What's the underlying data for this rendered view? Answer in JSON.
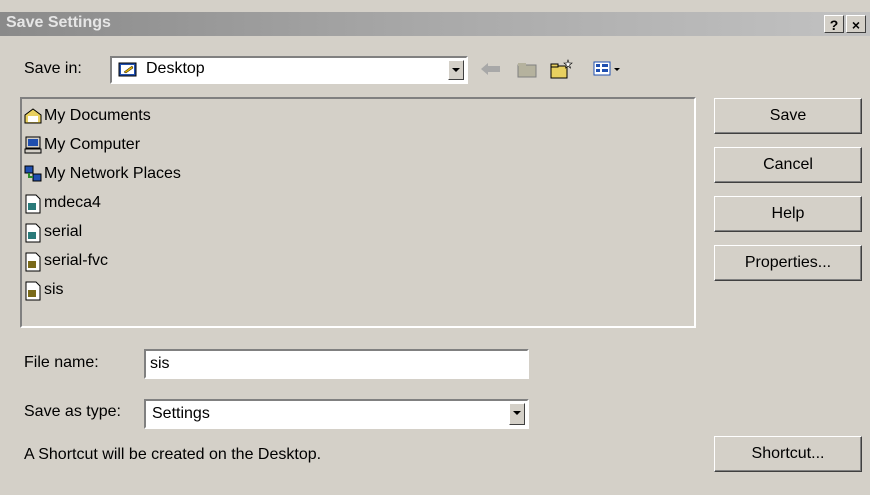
{
  "window": {
    "title": "Save Settings",
    "help_label": "?",
    "close_label": "×"
  },
  "save_in": {
    "label": "Save in:",
    "value": "Desktop"
  },
  "toolbar": {
    "icons": [
      "back-arrow-icon",
      "up-folder-icon",
      "new-folder-icon",
      "view-menu-icon"
    ]
  },
  "files": [
    {
      "name": "My Documents",
      "icon": "my-documents-icon"
    },
    {
      "name": "My Computer",
      "icon": "my-computer-icon"
    },
    {
      "name": "My Network Places",
      "icon": "network-places-icon"
    },
    {
      "name": "mdeca4",
      "icon": "settings-file-icon"
    },
    {
      "name": "serial",
      "icon": "settings-file-icon"
    },
    {
      "name": "serial-fvc",
      "icon": "settings-file-icon"
    },
    {
      "name": "sis",
      "icon": "settings-file-icon"
    }
  ],
  "buttons": {
    "save": "Save",
    "cancel": "Cancel",
    "help": "Help",
    "properties": "Properties...",
    "shortcut": "Shortcut..."
  },
  "file_name": {
    "label": "File name:",
    "value": "sis"
  },
  "save_as_type": {
    "label": "Save as type:",
    "value": "Settings"
  },
  "status": "A Shortcut will be created on the Desktop."
}
